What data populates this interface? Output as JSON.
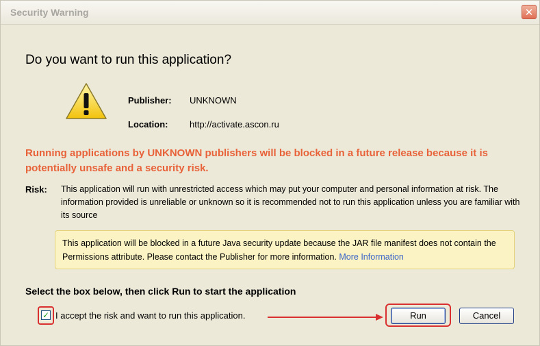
{
  "window": {
    "title": "Security Warning",
    "close_symbol": "✕"
  },
  "heading": "Do you want to run this application?",
  "details": {
    "publisher_label": "Publisher:",
    "publisher_value": "UNKNOWN",
    "location_label": "Location:",
    "location_value": "http://activate.ascon.ru"
  },
  "warning_text": "Running applications by UNKNOWN publishers will be blocked in a future release because it is potentially unsafe and a security risk.",
  "risk": {
    "label": "Risk:",
    "text": "This application will run with unrestricted access which may put your computer and personal information at risk. The information provided is unreliable or unknown so it is recommended not to run this application unless you are familiar with its source"
  },
  "notice": {
    "text": "This application will be blocked in a future Java security update because the JAR file manifest does not contain the Permissions attribute. Please contact the Publisher for more information.",
    "link": "More Information"
  },
  "instruction": "Select the box below, then click Run to start the application",
  "checkbox": {
    "checked": true,
    "mark": "✓",
    "label": "I accept the risk and want to run this application."
  },
  "buttons": {
    "run": "Run",
    "cancel": "Cancel"
  },
  "colors": {
    "warning_red": "#e8623a",
    "highlight": "#d92f2f",
    "link": "#3a64c8"
  },
  "icons": {
    "warning": "warning-triangle-icon",
    "close": "close-icon",
    "arrow": "arrow-right-icon"
  }
}
